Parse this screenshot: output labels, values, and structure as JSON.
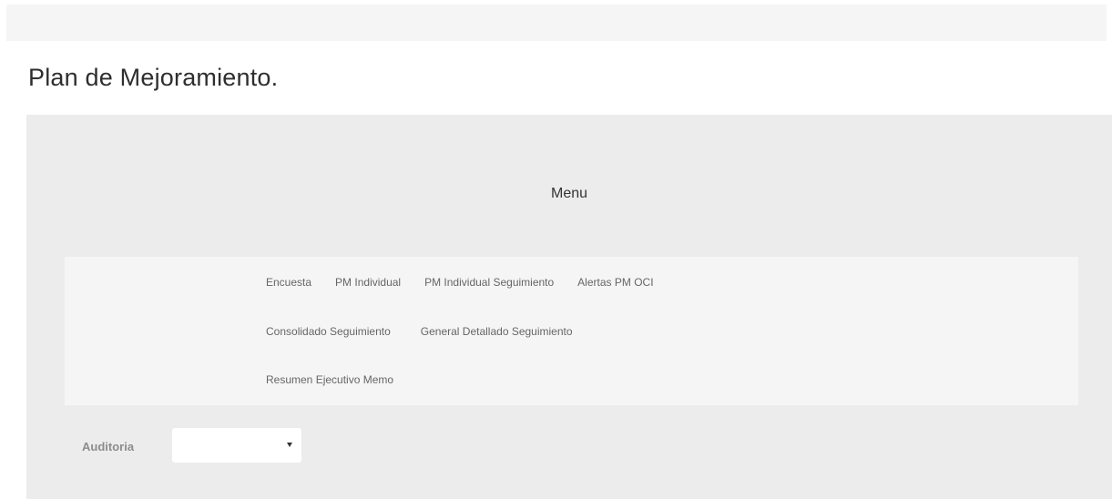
{
  "page": {
    "title": "Plan de Mejoramiento."
  },
  "menu": {
    "heading": "Menu",
    "row1": [
      "Encuesta",
      "PM Individual",
      "PM Individual Seguimiento",
      "Alertas PM OCI"
    ],
    "row2": [
      "Consolidado Seguimiento",
      "General Detallado Seguimiento"
    ],
    "row3": [
      "Resumen Ejecutivo Memo"
    ]
  },
  "filter": {
    "label": "Auditoria",
    "selected_value": "",
    "caret_icon": "chevron-down-icon"
  },
  "colors": {
    "panel_bg": "#ececec",
    "menu_box_bg": "#f5f5f5",
    "link_text": "#666666"
  }
}
